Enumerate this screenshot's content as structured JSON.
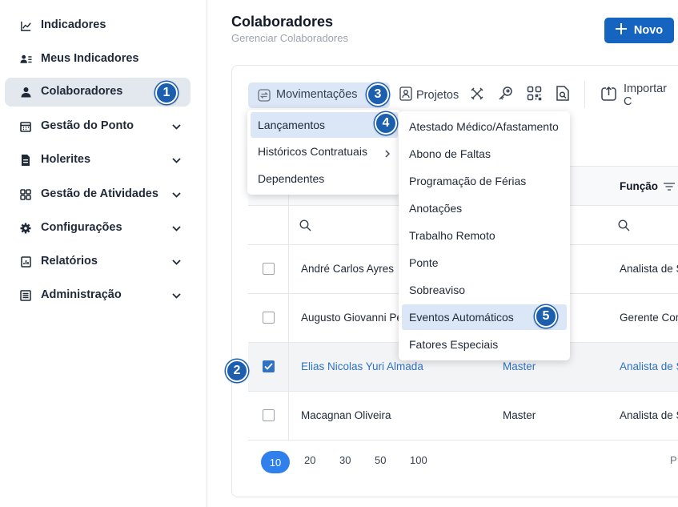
{
  "sidebar": {
    "items": [
      {
        "label": "Indicadores",
        "icon": "chart-line-icon",
        "chevron": false
      },
      {
        "label": "Meus Indicadores",
        "icon": "user-list-icon",
        "chevron": false
      },
      {
        "label": "Colaboradores",
        "icon": "user-icon",
        "chevron": false,
        "active": true
      },
      {
        "label": "Gestão do Ponto",
        "icon": "calendar-icon",
        "chevron": true
      },
      {
        "label": "Holerites",
        "icon": "document-icon",
        "chevron": true
      },
      {
        "label": "Gestão de Atividades",
        "icon": "grid-icon",
        "chevron": true
      },
      {
        "label": "Configurações",
        "icon": "gear-icon",
        "chevron": true
      },
      {
        "label": "Relatórios",
        "icon": "report-icon",
        "chevron": true
      },
      {
        "label": "Administração",
        "icon": "admin-icon",
        "chevron": true
      }
    ]
  },
  "header": {
    "title": "Colaboradores",
    "subtitle": "Gerenciar Colaboradores",
    "new_button": "Novo"
  },
  "toolbar": {
    "movimentacoes": "Movimentações",
    "projetos": "Projetos",
    "importar": "Importar C"
  },
  "menu": {
    "items": [
      "Lançamentos",
      "Históricos Contratuais",
      "Dependentes"
    ]
  },
  "submenu": {
    "items": [
      "Atestado Médico/Afastamento",
      "Abono de Faltas",
      "Programação de Férias",
      "Anotações",
      "Trabalho Remoto",
      "Ponte",
      "Sobreaviso",
      "Eventos Automáticos",
      "Fatores Especiais"
    ]
  },
  "table": {
    "header_funcao": "Função",
    "rows": [
      {
        "name": "André Carlos Ayres",
        "level": "",
        "role": "Analista de S",
        "checked": false
      },
      {
        "name": "Augusto Giovanni Pe",
        "level": "",
        "role": "Gerente Cor",
        "checked": false
      },
      {
        "name": "Elias Nicolas Yuri Almada",
        "level": "Master",
        "role": "Analista de S",
        "checked": true
      },
      {
        "name": "Macagnan Oliveira",
        "level": "Master",
        "role": "Analista de S",
        "checked": false
      }
    ]
  },
  "pagination": {
    "sizes": [
      "10",
      "20",
      "30",
      "50",
      "100"
    ],
    "trailing": "P"
  },
  "badges": [
    "1",
    "2",
    "3",
    "4",
    "5"
  ],
  "colors": {
    "primary": "#1565c0",
    "badge": "#1b5fae",
    "selected_bg": "#dbe6f6",
    "link": "#2f72c4"
  }
}
